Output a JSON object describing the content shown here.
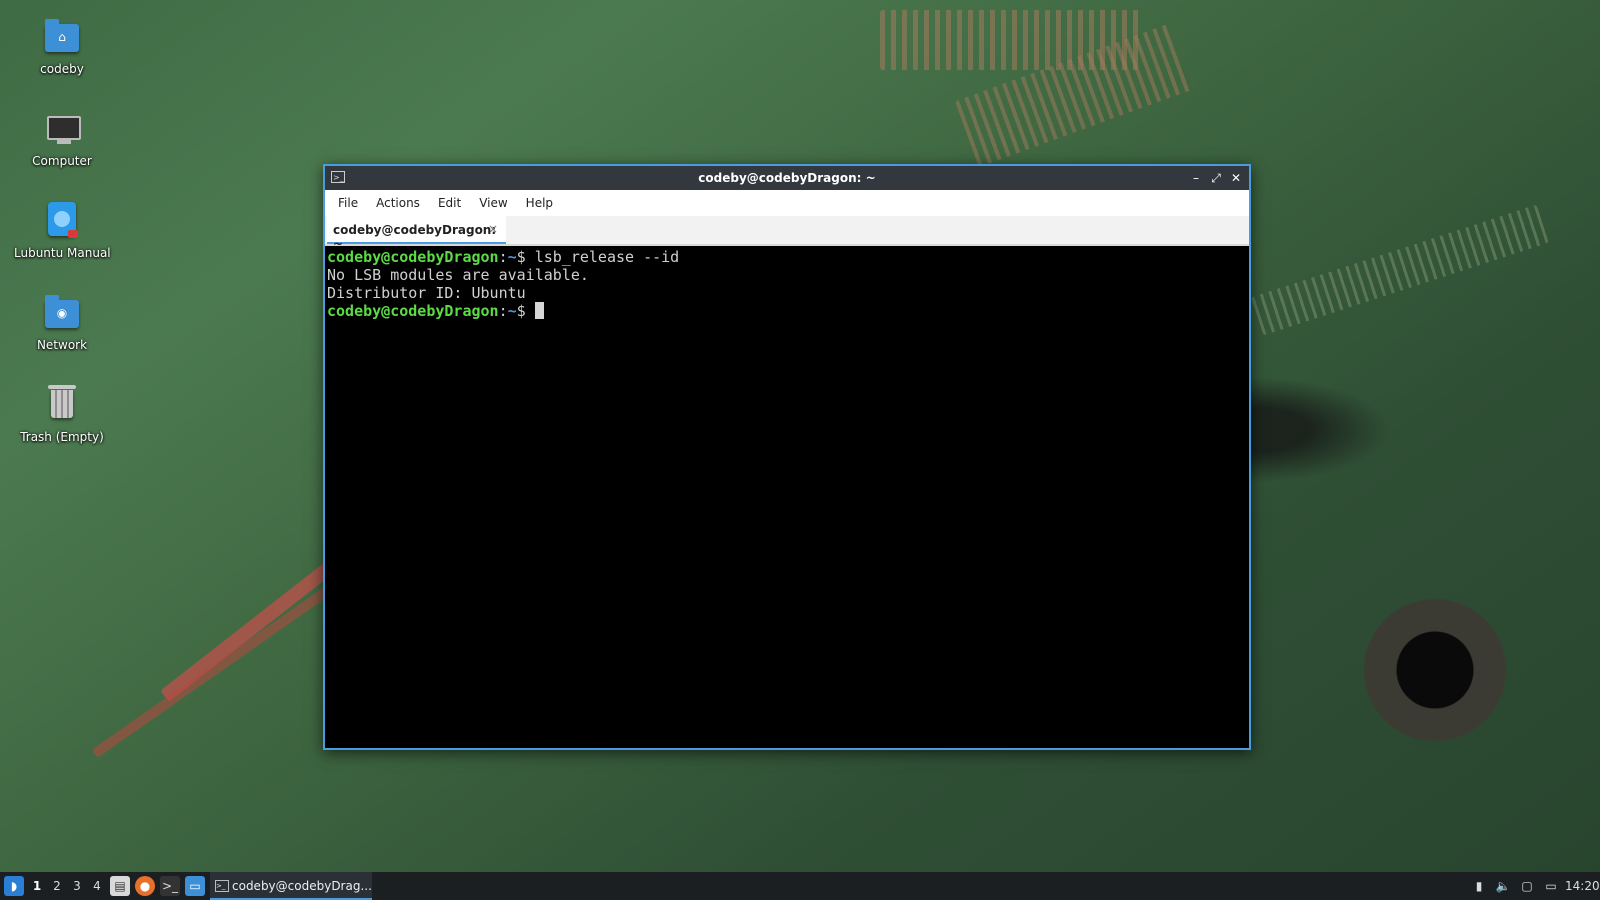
{
  "desktop": {
    "icons": [
      {
        "label": "codeby",
        "icon": "home-folder-icon"
      },
      {
        "label": "Computer",
        "icon": "computer-icon"
      },
      {
        "label": "Lubuntu Manual",
        "icon": "manual-icon"
      },
      {
        "label": "Network",
        "icon": "network-folder-icon"
      },
      {
        "label": "Trash (Empty)",
        "icon": "trash-icon"
      }
    ]
  },
  "window": {
    "title": "codeby@codebyDragon: ~",
    "icon": "terminal-icon",
    "menu": [
      "File",
      "Actions",
      "Edit",
      "View",
      "Help"
    ],
    "tab_label": "codeby@codebyDragon: ~",
    "tab_close": "×",
    "accent_color": "#4a9ce0"
  },
  "terminal": {
    "line1": {
      "user": "codeby@codebyDragon",
      "colon": ":",
      "path": "~",
      "dollar": "$ ",
      "command": "lsb_release --id"
    },
    "line2": "No LSB modules are available.",
    "line3": "Distributor ID: Ubuntu",
    "line4": {
      "user": "codeby@codebyDragon",
      "colon": ":",
      "path": "~",
      "dollar": "$ "
    },
    "prompt_color": "#5cdb45"
  },
  "taskbar": {
    "workspaces": [
      "1",
      "2",
      "3",
      "4"
    ],
    "active_workspace": "1",
    "task_label": "codeby@codebyDrag...",
    "clock": "14:20"
  }
}
